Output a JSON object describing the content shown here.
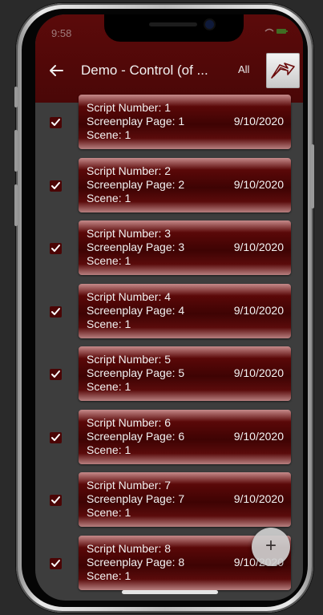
{
  "status": {
    "time": "9:58",
    "icons": "wifi battery"
  },
  "header": {
    "title": "Demo - Control (of ...",
    "all_label": "All"
  },
  "rows": [
    {
      "checked": true,
      "script": "Script Number: 1",
      "page": "Screenplay Page: 1",
      "scene": "Scene: 1",
      "date": "9/10/2020"
    },
    {
      "checked": true,
      "script": "Script Number: 2",
      "page": "Screenplay Page: 2",
      "scene": "Scene: 1",
      "date": "9/10/2020"
    },
    {
      "checked": true,
      "script": "Script Number: 3",
      "page": "Screenplay Page: 3",
      "scene": "Scene: 1",
      "date": "9/10/2020"
    },
    {
      "checked": true,
      "script": "Script Number: 4",
      "page": "Screenplay Page: 4",
      "scene": "Scene: 1",
      "date": "9/10/2020"
    },
    {
      "checked": true,
      "script": "Script Number: 5",
      "page": "Screenplay Page: 5",
      "scene": "Scene: 1",
      "date": "9/10/2020"
    },
    {
      "checked": true,
      "script": "Script Number: 6",
      "page": "Screenplay Page: 6",
      "scene": "Scene: 1",
      "date": "9/10/2020"
    },
    {
      "checked": true,
      "script": "Script Number: 7",
      "page": "Screenplay Page: 7",
      "scene": "Scene: 1",
      "date": "9/10/2020"
    },
    {
      "checked": true,
      "script": "Script Number: 8",
      "page": "Screenplay Page: 8",
      "scene": "Scene: 1",
      "date": "9/10/2020"
    }
  ],
  "fab": {
    "label": "+"
  },
  "colors": {
    "header": "#5b0a0a",
    "card": "#3e0303",
    "checkbox": "#4b0505",
    "background": "#3d3d3d"
  },
  "icons": {
    "back": "arrow-left-icon",
    "logo": "arrow-logo-icon",
    "check": "checkmark-icon",
    "add": "plus-icon"
  }
}
